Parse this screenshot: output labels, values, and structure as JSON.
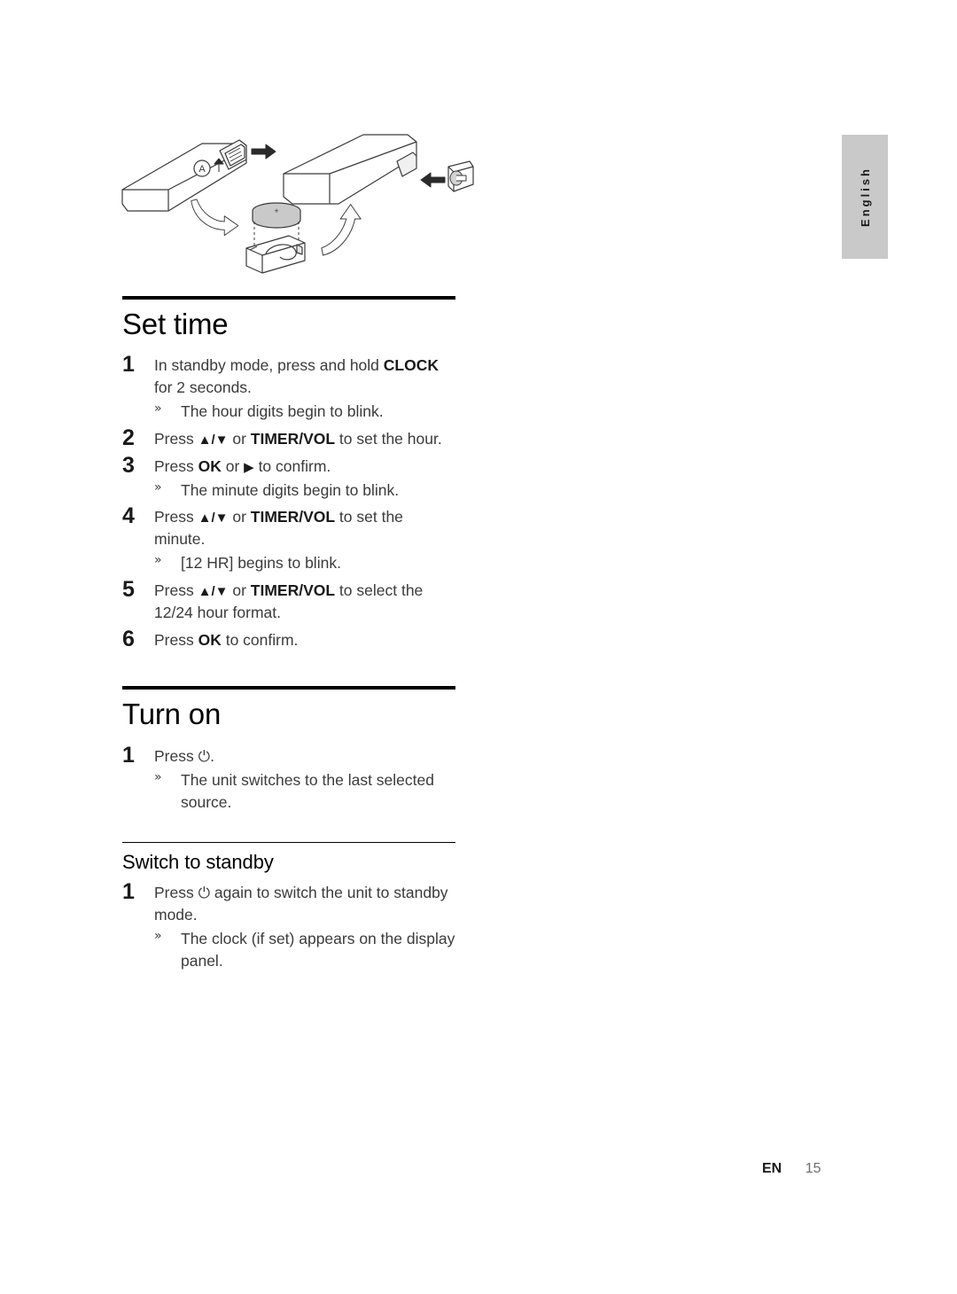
{
  "page": {
    "language_tab": "English",
    "footer": {
      "locale_code": "EN",
      "page_number": "15"
    }
  },
  "illustration": {
    "caption_label": "A",
    "alt": "Remote control battery tray removal and coin cell battery replacement diagram"
  },
  "sections": [
    {
      "id": "set-time",
      "title": "Set time",
      "rule": "thick",
      "steps": [
        {
          "number": "1",
          "text_parts": [
            {
              "t": "In standby mode, press and hold ",
              "bold": false
            },
            {
              "t": "CLOCK",
              "bold": true
            },
            {
              "t": " for 2 seconds.",
              "bold": false
            }
          ],
          "results": [
            "The hour digits begin to blink."
          ]
        },
        {
          "number": "2",
          "text_parts": [
            {
              "t": "Press ",
              "bold": false
            },
            {
              "t": "▲/▼",
              "bold": true
            },
            {
              "t": " or ",
              "bold": false
            },
            {
              "t": "TIMER/VOL",
              "bold": true
            },
            {
              "t": " to set the hour.",
              "bold": false
            }
          ],
          "results": []
        },
        {
          "number": "3",
          "text_parts": [
            {
              "t": "Press ",
              "bold": false
            },
            {
              "t": "OK",
              "bold": true
            },
            {
              "t": " or ",
              "bold": false
            },
            {
              "t": "▶",
              "bold": true
            },
            {
              "t": " to confirm.",
              "bold": false
            }
          ],
          "results": [
            "The minute digits begin to blink."
          ]
        },
        {
          "number": "4",
          "text_parts": [
            {
              "t": "Press ",
              "bold": false
            },
            {
              "t": "▲/▼",
              "bold": true
            },
            {
              "t": " or ",
              "bold": false
            },
            {
              "t": "TIMER/VOL",
              "bold": true
            },
            {
              "t": " to set the minute.",
              "bold": false
            }
          ],
          "results": [
            "[12 HR] begins to blink."
          ]
        },
        {
          "number": "5",
          "text_parts": [
            {
              "t": "Press ",
              "bold": false
            },
            {
              "t": "▲/▼",
              "bold": true
            },
            {
              "t": " or ",
              "bold": false
            },
            {
              "t": "TIMER/VOL",
              "bold": true
            },
            {
              "t": " to select the 12/24 hour format.",
              "bold": false
            }
          ],
          "results": []
        },
        {
          "number": "6",
          "text_parts": [
            {
              "t": "Press ",
              "bold": false
            },
            {
              "t": "OK",
              "bold": true
            },
            {
              "t": " to confirm.",
              "bold": false
            }
          ],
          "results": []
        }
      ]
    },
    {
      "id": "turn-on",
      "title": "Turn on",
      "rule": "thick",
      "steps": [
        {
          "number": "1",
          "text_parts": [
            {
              "t": "Press ",
              "bold": false
            },
            {
              "t": "⏻",
              "bold": false,
              "symbol": true
            },
            {
              "t": ".",
              "bold": false
            }
          ],
          "results": [
            "The unit switches to the last selected source."
          ]
        }
      ]
    },
    {
      "id": "switch-to-standby",
      "title": "Switch to standby",
      "rule": "thin",
      "steps": [
        {
          "number": "1",
          "text_parts": [
            {
              "t": "Press ",
              "bold": false
            },
            {
              "t": "⏻",
              "bold": false,
              "symbol": true
            },
            {
              "t": " again to switch the unit to standby mode.",
              "bold": false
            }
          ],
          "results": [
            "The clock (if set) appears on the display panel."
          ]
        }
      ]
    }
  ]
}
